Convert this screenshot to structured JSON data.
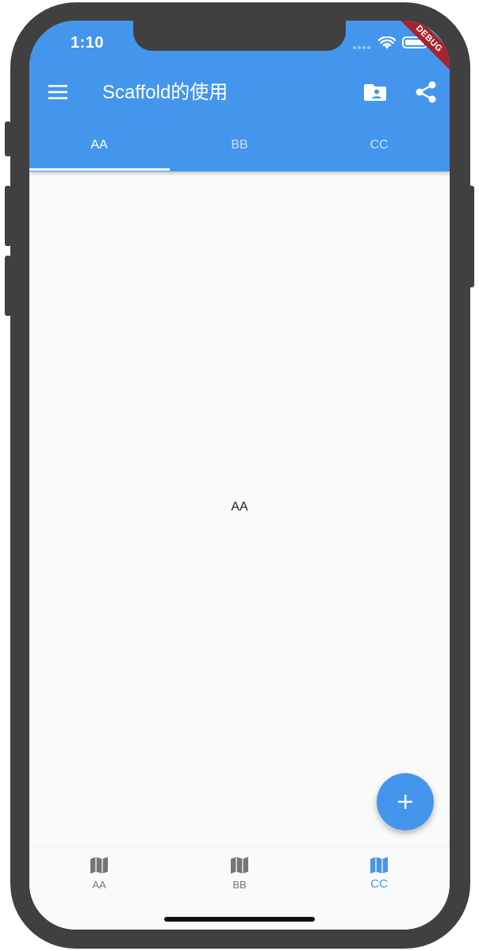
{
  "status_bar": {
    "time": "1:10"
  },
  "debug_banner": "DEBUG",
  "app_bar": {
    "title": "Scaffold的使用",
    "menu_icon": "menu-icon",
    "actions": [
      "folder-shared-icon",
      "share-icon"
    ],
    "background_color": "#4496ec"
  },
  "tabs": [
    {
      "label": "AA",
      "selected": true
    },
    {
      "label": "BB",
      "selected": false
    },
    {
      "label": "CC",
      "selected": false
    }
  ],
  "body": {
    "text": "AA"
  },
  "fab": {
    "icon": "add-icon",
    "color": "#4496ec"
  },
  "bottom_nav": [
    {
      "label": "AA",
      "icon": "map-icon",
      "selected": false
    },
    {
      "label": "BB",
      "icon": "map-icon",
      "selected": false
    },
    {
      "label": "CC",
      "icon": "map-icon",
      "selected": true
    }
  ],
  "colors": {
    "accent": "#4496ec",
    "inactive_nav": "#757575",
    "debug_banner": "#a6242b"
  }
}
